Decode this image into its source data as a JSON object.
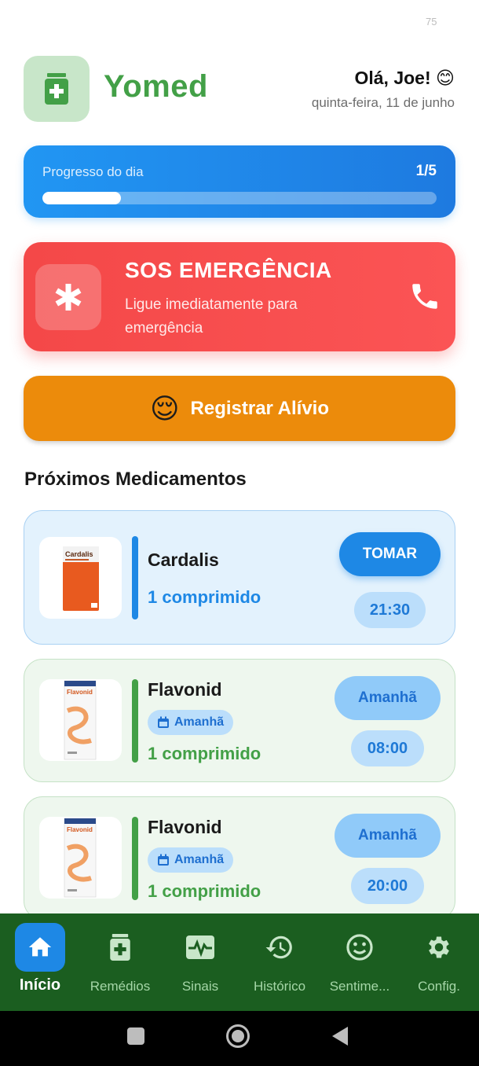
{
  "status": {
    "number": "75"
  },
  "header": {
    "app_name": "Yomed",
    "greeting": "Olá, Joe! 😊",
    "date": "quinta-feira, 11 de junho"
  },
  "progress": {
    "label": "Progresso do dia",
    "count": "1/5",
    "fraction": 0.2
  },
  "sos": {
    "title": "SOS EMERGÊNCIA",
    "description": "Ligue imediatamente para emergência"
  },
  "relief": {
    "emoji": "😌",
    "label": "Registrar Alívio"
  },
  "section_title": "Próximos Medicamentos",
  "medications": [
    {
      "name": "Cardalis",
      "dose": "1 comprimido",
      "action": "TOMAR",
      "time": "21:30",
      "package_text": "Cardalis"
    },
    {
      "name": "Flavonid",
      "chip": "Amanhã",
      "dose": "1 comprimido",
      "action": "Amanhã",
      "time": "08:00",
      "package_text": "Flavonid"
    },
    {
      "name": "Flavonid",
      "chip": "Amanhã",
      "dose": "1 comprimido",
      "action": "Amanhã",
      "time": "20:00",
      "package_text": "Flavonid"
    }
  ],
  "nav": [
    {
      "label": "Início",
      "icon": "home-icon",
      "active": true
    },
    {
      "label": "Remédios",
      "icon": "medicine-icon"
    },
    {
      "label": "Sinais",
      "icon": "vitals-icon"
    },
    {
      "label": "Histórico",
      "icon": "history-icon"
    },
    {
      "label": "Sentime...",
      "icon": "mood-icon"
    },
    {
      "label": "Config.",
      "icon": "gear-icon"
    }
  ],
  "colors": {
    "brand_green": "#43a047",
    "progress_blue": "#2196f3",
    "sos_red": "#f44848",
    "relief_orange": "#ec8b0b",
    "nav_bg": "#1b5e20",
    "nav_active": "#1e88e5"
  }
}
